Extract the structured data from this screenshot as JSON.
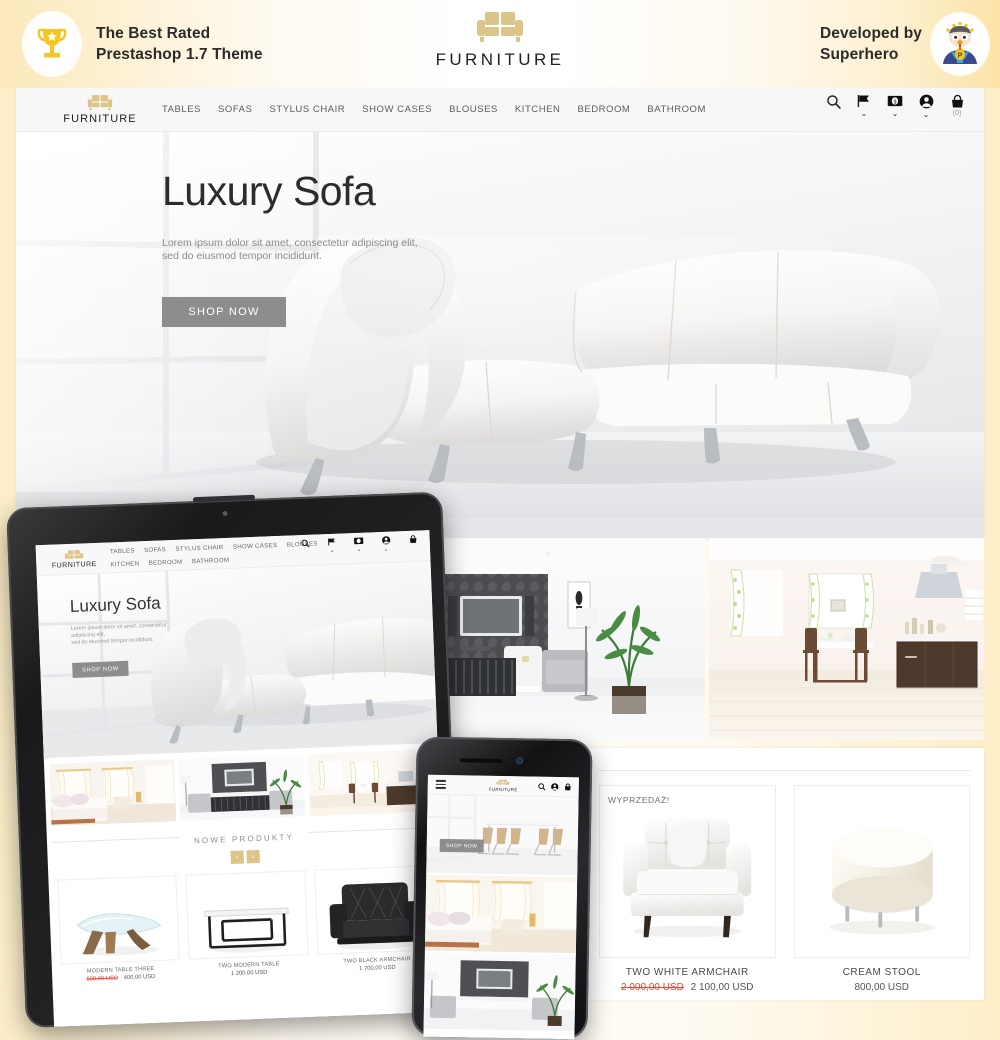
{
  "promo": {
    "left_badge_icon": "trophy-icon",
    "left_line1": "The Best Rated",
    "left_line2": "Prestashop 1.7 Theme",
    "center_logo_icon": "sofa-logo-icon",
    "center_logo_text": "FURNITURE",
    "right_line1": "Developed by",
    "right_line2": "Superhero",
    "right_badge_icon": "superhero-mascot-icon",
    "accent": "#ddc488",
    "gold": "#f5c518"
  },
  "site": {
    "logo_text": "FURNITURE",
    "menu": [
      "TABLES",
      "SOFAS",
      "STYLUS CHAIR",
      "SHOW CASES",
      "BLOUSES",
      "KITCHEN",
      "BEDROOM",
      "BATHROOM"
    ],
    "icons": [
      {
        "name": "search-icon",
        "chevron": false,
        "count": ""
      },
      {
        "name": "flag-language-icon",
        "chevron": true,
        "count": ""
      },
      {
        "name": "currency-icon",
        "chevron": true,
        "count": ""
      },
      {
        "name": "account-icon",
        "chevron": true,
        "count": ""
      },
      {
        "name": "cart-icon",
        "chevron": false,
        "count": "(0)"
      }
    ],
    "slide": {
      "title": "Luxury Sofa",
      "desc_line1": "Lorem ipsum dolor sit amet, consectetur adipiscing elit,",
      "desc_line2": "sed do eiusmod tempor incididunt.",
      "cta": "SHOP NOW"
    }
  },
  "rooms": [
    {
      "name": "living-room-tv-photo"
    },
    {
      "name": "dining-kitchen-photo"
    }
  ],
  "products_panel": {
    "items": [
      {
        "name": "TWO WHITE ARMCHAIR",
        "badge": "WYPRZEDAŻ!",
        "old_price": "2 000,00 USD",
        "price": "2 100,00 USD",
        "image": "white-armchair-photo"
      },
      {
        "name": "CREAM STOOL",
        "badge": "",
        "old_price": "",
        "price": "800,00 USD",
        "image": "cream-stool-photo"
      }
    ]
  },
  "tablet": {
    "logo_text": "FURNITURE",
    "menu": [
      "TABLES",
      "SOFAS",
      "STYLUS CHAIR",
      "SHOW CASES",
      "BLOUSES",
      "KITCHEN",
      "BEDROOM",
      "BATHROOM"
    ],
    "icons": [
      {
        "name": "search-icon",
        "chevron": false
      },
      {
        "name": "flag-language-icon",
        "chevron": true
      },
      {
        "name": "currency-icon",
        "chevron": true
      },
      {
        "name": "account-icon",
        "chevron": true
      },
      {
        "name": "cart-icon",
        "chevron": false
      }
    ],
    "slide": {
      "title": "Luxury Sofa",
      "desc_line1": "Lorem ipsum dolor sit amet, consectetur",
      "desc_line2": "adipiscing elit,",
      "desc_line3": "sed do eiusmod tempor incididunt.",
      "cta": "SHOP NOW"
    },
    "categories": [
      {
        "name": "bedroom-category-photo"
      },
      {
        "name": "living-room-category-photo"
      },
      {
        "name": "dining-category-photo"
      }
    ],
    "section_title": "NOWE PRODUKTY",
    "prev_label": "‹",
    "next_label": "›",
    "products": [
      {
        "name": "MODERN TABLE THREE",
        "old_price": "500,00 USD",
        "price": "400,00 USD",
        "image": "glass-coffee-table-photo"
      },
      {
        "name": "TWO MODERN TABLE",
        "old_price": "",
        "price": "1 200,00 USD",
        "image": "black-frame-table-photo"
      },
      {
        "name": "TWO BLACK ARMCHAIR",
        "old_price": "",
        "price": "1 700,00 USD",
        "image": "black-leather-armchair-photo"
      }
    ]
  },
  "phone": {
    "logo_text": "FURNITURE",
    "menu_icon": "hamburger-menu-icon",
    "icons": [
      {
        "name": "search-icon"
      },
      {
        "name": "account-icon"
      },
      {
        "name": "cart-icon"
      }
    ],
    "slide": {
      "cta": "SHOP NOW"
    },
    "panels": [
      {
        "name": "dining-room-slide-photo"
      },
      {
        "name": "bedroom-slide-photo"
      },
      {
        "name": "living-room-slide-photo"
      }
    ]
  }
}
